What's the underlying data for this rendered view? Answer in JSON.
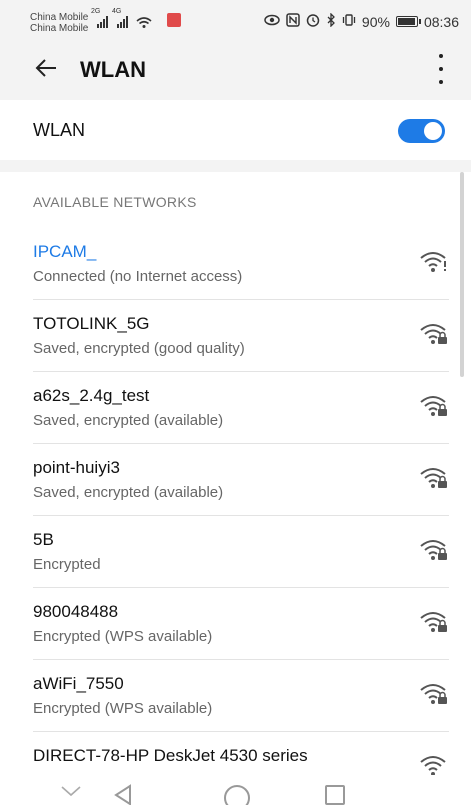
{
  "status_bar": {
    "carrier_1": "China Mobile",
    "carrier_2": "China Mobile",
    "network_1": "2G",
    "network_2": "4G",
    "battery": "90%",
    "time": "08:36",
    "icons": [
      "eye-icon",
      "nfc-icon",
      "alarm-icon",
      "bluetooth-icon",
      "vibrate-icon"
    ]
  },
  "header": {
    "title": "WLAN",
    "back_icon": "arrow-left-icon",
    "more_icon": "more-vertical-icon"
  },
  "wlan_toggle": {
    "label": "WLAN",
    "on": true
  },
  "networks": {
    "section_title": "AVAILABLE NETWORKS",
    "items": [
      {
        "name": "IPCAM_",
        "status": "Connected (no Internet access)",
        "connected": true,
        "icon": "wifi-no-internet-icon"
      },
      {
        "name": "TOTOLINK_5G",
        "status": "Saved, encrypted (good quality)",
        "connected": false,
        "icon": "wifi-lock-icon"
      },
      {
        "name": "a62s_2.4g_test",
        "status": "Saved, encrypted (available)",
        "connected": false,
        "icon": "wifi-lock-icon"
      },
      {
        "name": "point-huiyi3",
        "status": "Saved, encrypted (available)",
        "connected": false,
        "icon": "wifi-lock-icon"
      },
      {
        "name": "5B",
        "status": "Encrypted",
        "connected": false,
        "icon": "wifi-lock-icon"
      },
      {
        "name": "980048488",
        "status": "Encrypted (WPS available)",
        "connected": false,
        "icon": "wifi-lock-icon"
      },
      {
        "name": "aWiFi_7550",
        "status": "Encrypted (WPS available)",
        "connected": false,
        "icon": "wifi-lock-icon"
      },
      {
        "name": "DIRECT-78-HP DeskJet 4530 series",
        "status": "",
        "connected": false,
        "icon": "wifi-icon"
      }
    ]
  },
  "colors": {
    "accent": "#1e7be6",
    "background_band": "#f3f3f3",
    "secondary_text": "#666666"
  }
}
